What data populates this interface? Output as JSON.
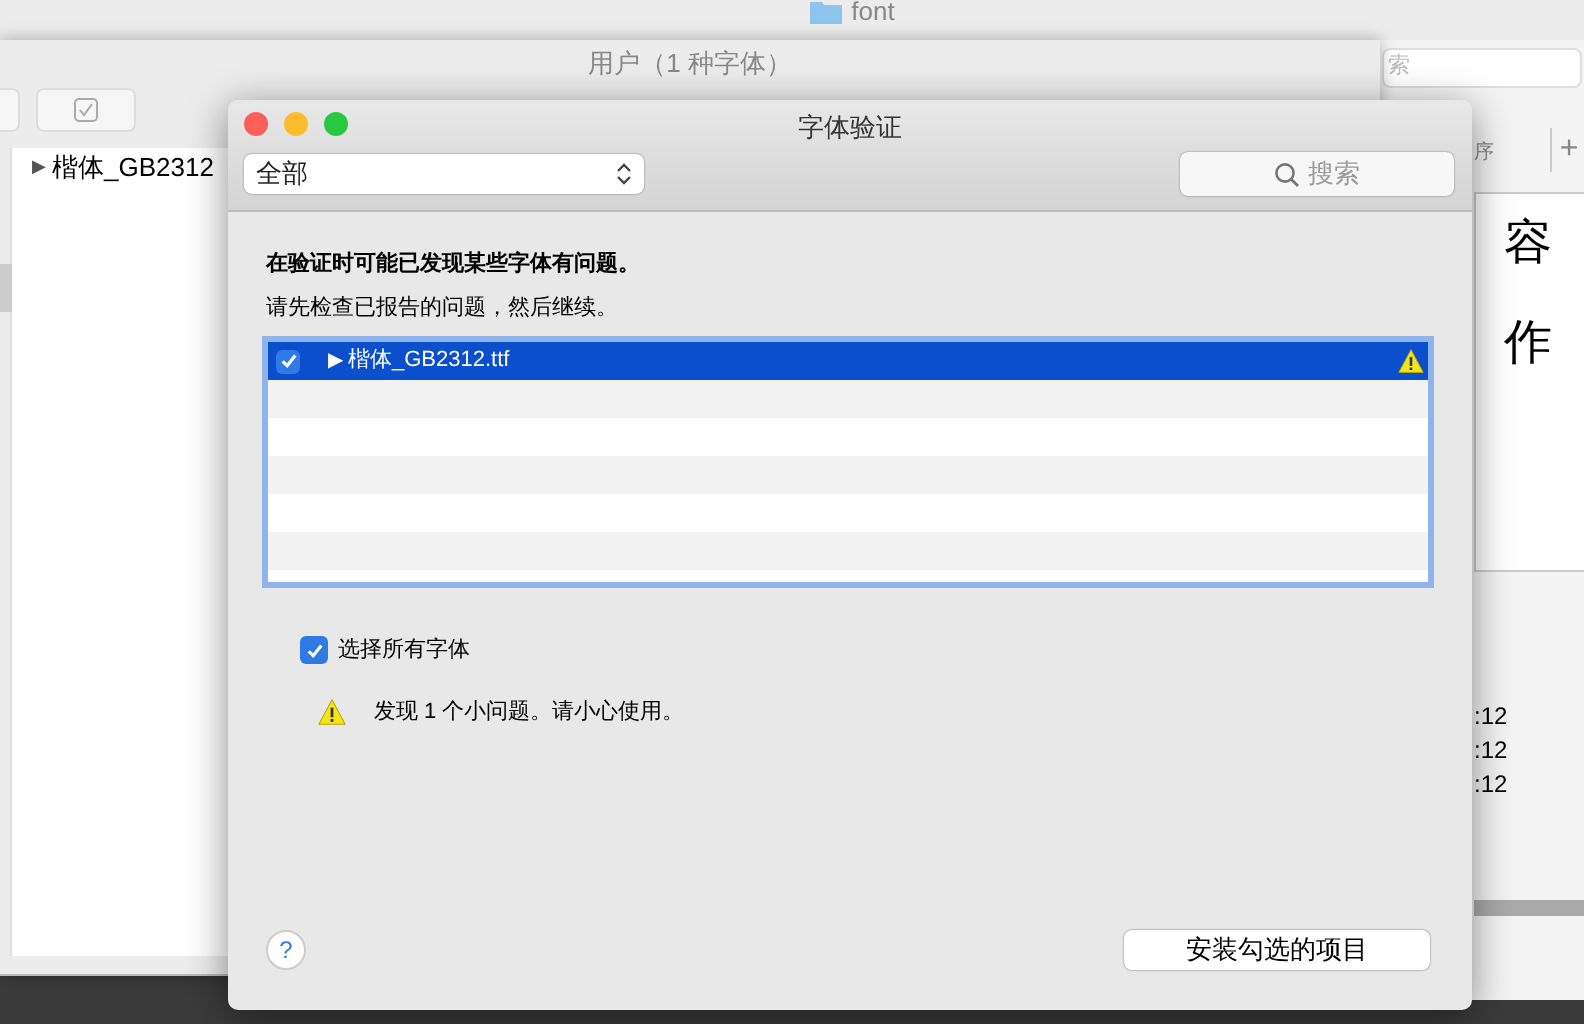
{
  "finder": {
    "title": "font"
  },
  "font_book": {
    "title": "用户（1 种字体）",
    "sidebar_items": [
      {
        "expander": "▶",
        "label": "楷体_GB2312",
        "selected": false
      }
    ]
  },
  "preview": {
    "search_part": "索",
    "column_part": "序",
    "add_button": "+",
    "sample_lines": [
      "容",
      "作"
    ],
    "times": [
      ":12",
      ":12",
      ":12"
    ]
  },
  "dialog": {
    "title": "字体验证",
    "filter": {
      "value": "全部"
    },
    "search": {
      "placeholder": "搜索"
    },
    "heading": "在验证时可能已发现某些字体有问题。",
    "subheading": "请先检查已报告的问题，然后继续。",
    "rows": [
      {
        "checked": true,
        "expander": "▶",
        "name": "楷体_GB2312.ttf",
        "selected": true,
        "warning": true
      }
    ],
    "select_all": {
      "label": "选择所有字体",
      "checked": true
    },
    "notice": "发现 1 个小问题。请小心使用。",
    "help_button": "?",
    "install_button": "安装勾选的项目"
  }
}
